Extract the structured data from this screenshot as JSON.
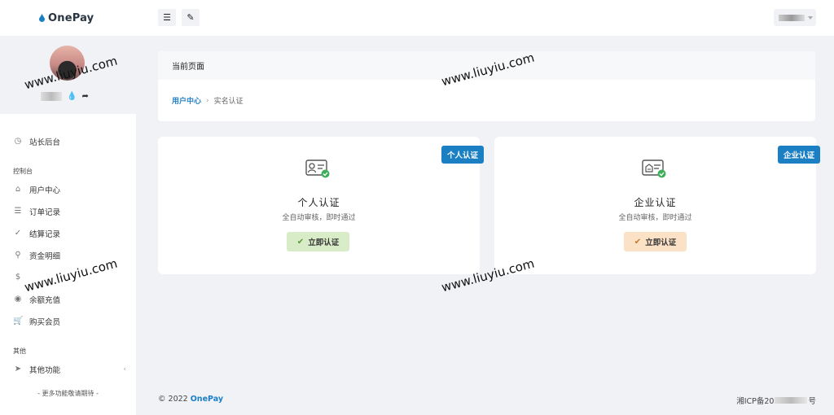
{
  "brand": {
    "name": "OnePay",
    "color": "#1b7fc4"
  },
  "sidebar": {
    "top_items": [
      {
        "label": "站长后台",
        "icon": "dashboard-icon"
      }
    ],
    "section_console": "控制台",
    "console_items": [
      {
        "label": "用户中心",
        "icon": "home-icon"
      },
      {
        "label": "订单记录",
        "icon": "list-icon"
      },
      {
        "label": "结算记录",
        "icon": "check-circle-icon"
      },
      {
        "label": "资金明细",
        "icon": "search-icon"
      },
      {
        "label": "",
        "icon": "dollar-icon"
      },
      {
        "label": "余额充值",
        "icon": "coins-icon"
      },
      {
        "label": "购买会员",
        "icon": "cart-icon"
      }
    ],
    "section_other": "其他",
    "other_items": [
      {
        "label": "其他功能",
        "icon": "rocket-icon"
      }
    ],
    "more_tip": "- 更多功能敬请期待 -"
  },
  "breadcrumb": {
    "header": "当前页面",
    "home": "用户中心",
    "current": "实名认证"
  },
  "cards": {
    "personal": {
      "badge": "个人认证",
      "title": "个人认证",
      "subtitle": "全自动审核，即时通过",
      "button": "立即认证"
    },
    "company": {
      "badge": "企业认证",
      "title": "企业认证",
      "subtitle": "全自动审核，即时通过",
      "button": "立即认证"
    }
  },
  "footer": {
    "copyright_prefix": "© 2022",
    "brand": "OnePay",
    "icp_prefix": "湘ICP备20",
    "icp_suffix": "号"
  },
  "watermark": "www.liuyiu.com"
}
